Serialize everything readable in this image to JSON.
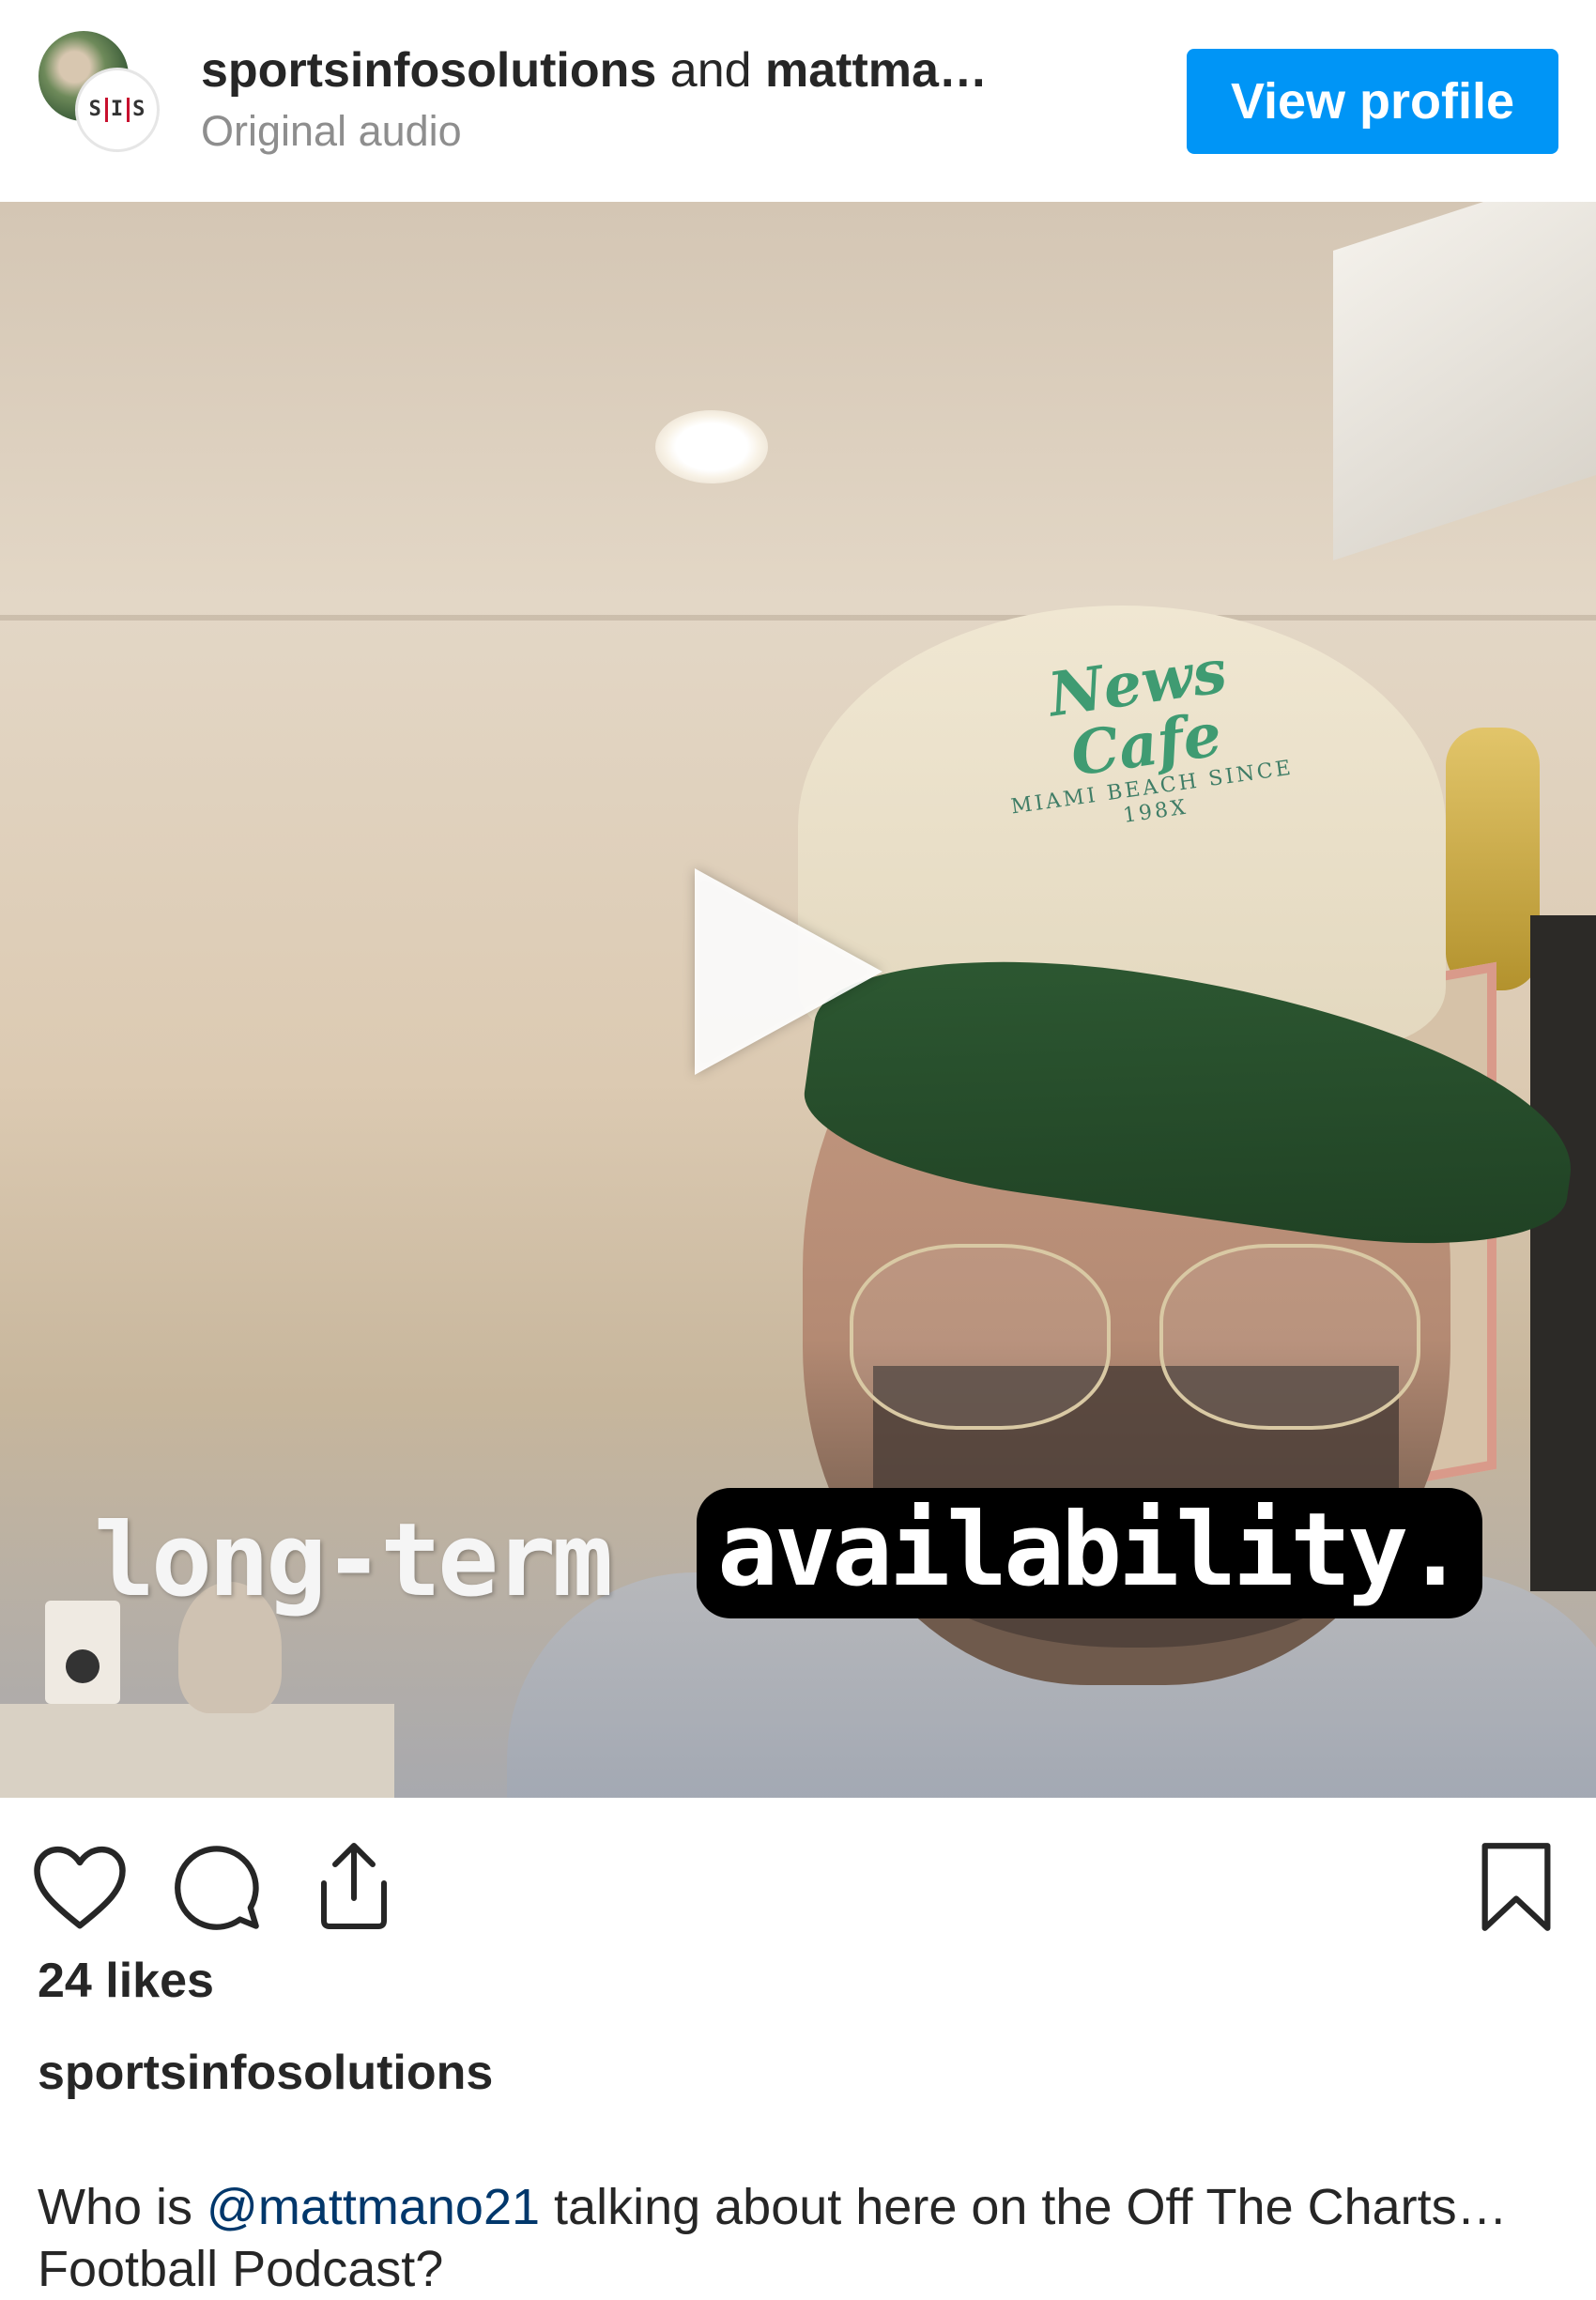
{
  "header": {
    "author_primary": "sportsinfosolutions",
    "joiner": " and ",
    "author_secondary": "mattma…",
    "audio_label": "Original audio",
    "view_profile_label": "View profile",
    "logo_text": "SIS"
  },
  "video": {
    "caption_plain": "long-term",
    "caption_highlight": "availability.",
    "cap_logo_top": "News Cafe",
    "cap_logo_bottom": "MIAMI BEACH SINCE 198X"
  },
  "actions": {
    "icons": [
      "heart-icon",
      "comment-icon",
      "share-icon",
      "bookmark-icon"
    ]
  },
  "post": {
    "likes": "24 likes",
    "caption_user": "sportsinfosolutions",
    "caption_prefix": "Who is ",
    "caption_mention": "@mattmano21",
    "caption_suffix": " talking about here on the Off The Charts…",
    "caption_line2": "Football Podcast?"
  },
  "colors": {
    "accent": "#0095f6",
    "mention": "#00376b",
    "muted": "#8e8e8e",
    "text": "#262626"
  }
}
